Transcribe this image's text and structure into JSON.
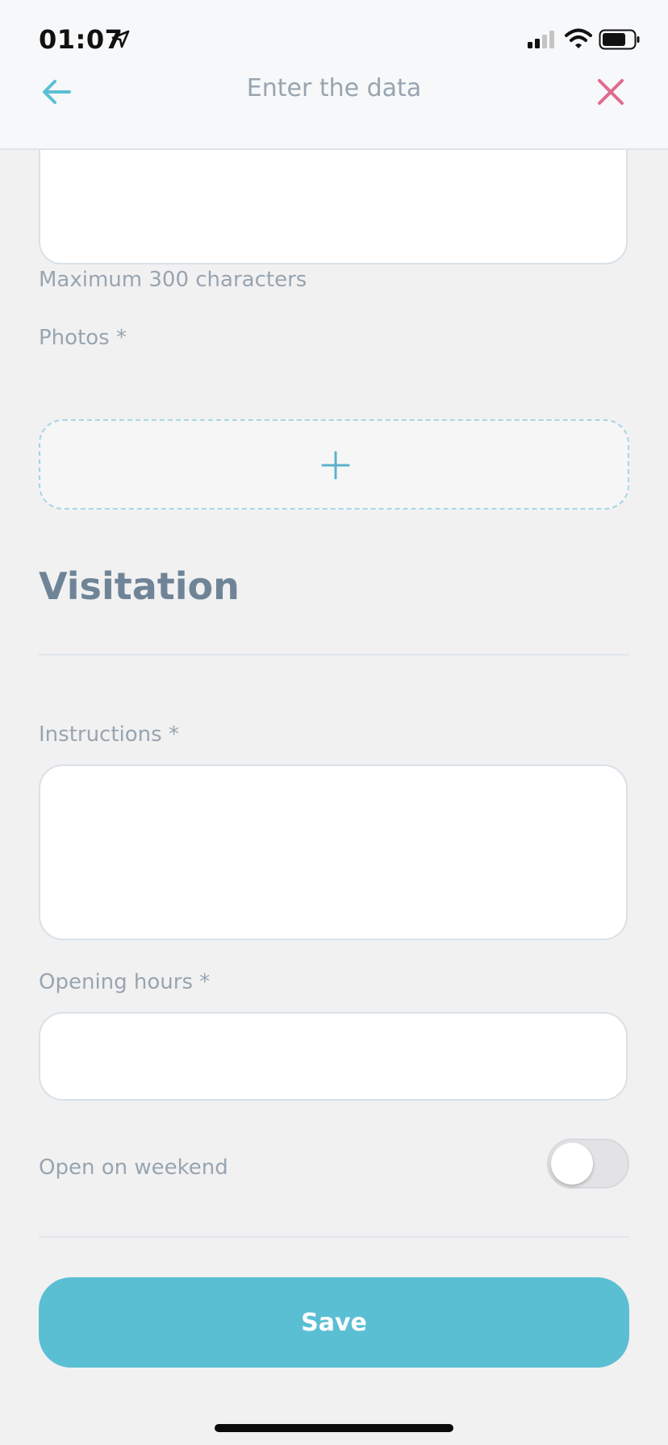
{
  "status_bar": {
    "time": "01:07",
    "location_icon": "location-arrow-icon",
    "signal_icon": "cellular-signal-icon",
    "wifi_icon": "wifi-icon",
    "battery_icon": "battery-icon"
  },
  "header": {
    "title": "Enter the data",
    "back_icon": "arrow-left-icon",
    "close_icon": "close-icon",
    "accent_color": "#5bbfd3",
    "close_color": "#e06a8f"
  },
  "description": {
    "value": "",
    "hint": "Maximum 300 characters"
  },
  "photos": {
    "label": "Photos *",
    "add_icon": "plus-icon"
  },
  "visitation": {
    "title": "Visitation"
  },
  "instructions": {
    "label": "Instructions *",
    "value": ""
  },
  "opening_hours": {
    "label": "Opening hours *",
    "value": ""
  },
  "weekend": {
    "label": "Open on weekend",
    "enabled": false
  },
  "actions": {
    "save_label": "Save",
    "save_color": "#5bbfd3"
  }
}
